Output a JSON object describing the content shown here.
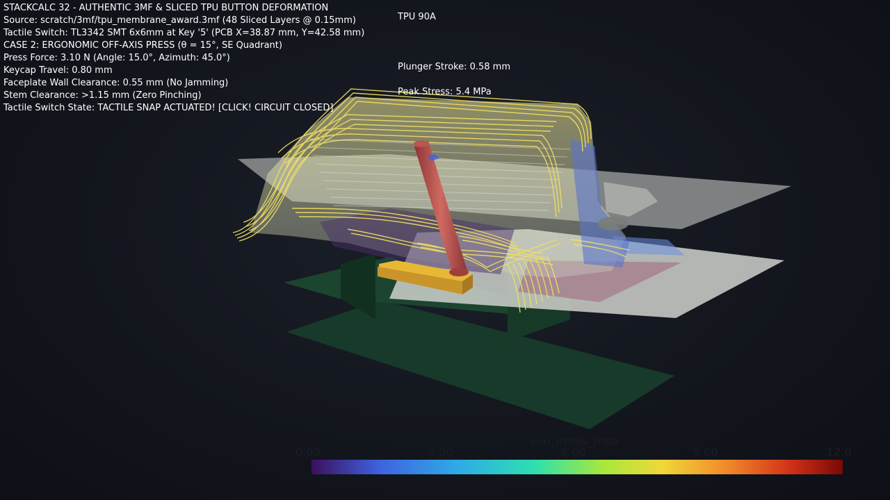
{
  "overlay": {
    "lines": [
      "STACKCALC 32 - AUTHENTIC 3MF & SLICED TPU BUTTON DEFORMATION",
      "Source: scratch/3mf/tpu_membrane_award.3mf (48 Sliced Layers @ 0.15mm)",
      "Tactile Switch: TL3342 SMT 6x6mm at Key '5' (PCB X=38.87 mm, Y=42.58 mm)",
      "CASE 2: ERGONOMIC OFF-AXIS PRESS (θ = 15°, SE Quadrant)",
      "Press Force: 3.10 N (Angle: 15.0°, Azimuth: 45.0°)",
      "Keycap Travel: 0.80 mm",
      "Faceplate Wall Clearance: 0.55 mm (No Jamming)",
      "Stem Clearance: >1.15 mm (Zero Pinching)",
      "Tactile Switch State: TACTILE SNAP ACTUATED! [CLICK! CIRCUIT CLOSED]"
    ],
    "material": "TPU 90A",
    "plunger_stroke": "Plunger Stroke: 0.58 mm",
    "peak_stress": "Peak Stress:  5.4 MPa"
  },
  "colorbar": {
    "title": "von_mises_mpa",
    "ticks": [
      "0.00",
      "3.00",
      "6.00",
      "9.00",
      "12.0"
    ],
    "colors": [
      "#3b0f5e",
      "#3f63e0",
      "#2fa8e8",
      "#2de0b0",
      "#a8e83c",
      "#f0d838",
      "#f28a2a",
      "#d23216",
      "#7a0806"
    ]
  },
  "scene": {
    "background": "#12151c",
    "pcb_color": "#173a2a",
    "faceplate_color": "#cfd2cc",
    "membrane_color": "#ece58a",
    "plunger_color": "#c05050",
    "switch_color": "#e0b030"
  }
}
